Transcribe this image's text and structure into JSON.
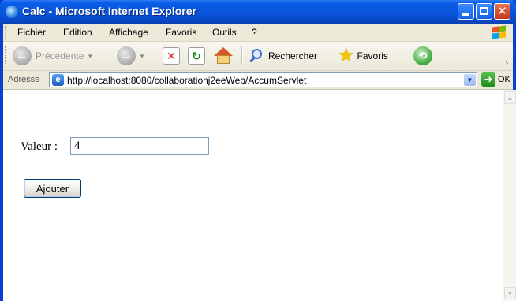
{
  "window": {
    "title": "Calc - Microsoft Internet Explorer"
  },
  "menu": {
    "items": [
      "Fichier",
      "Edition",
      "Affichage",
      "Favoris",
      "Outils",
      "?"
    ]
  },
  "toolbar": {
    "back_label": "Précédente",
    "search_label": "Rechercher",
    "favorites_label": "Favoris"
  },
  "address": {
    "label": "Adresse",
    "url": "http://localhost:8080/collaborationj2eeWeb/AccumServlet",
    "go_label": "OK"
  },
  "form": {
    "label": "Valeur :",
    "input_value": "4",
    "button_label": "Ajouter"
  }
}
